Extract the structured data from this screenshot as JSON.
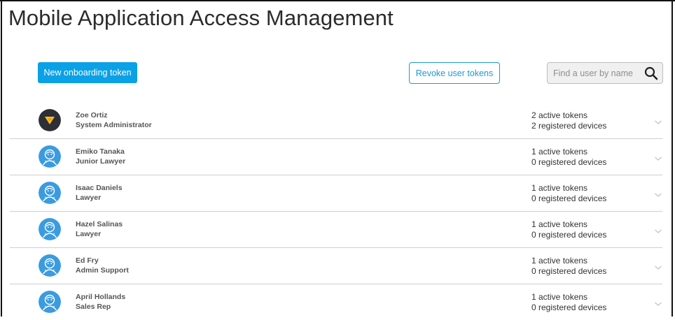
{
  "page": {
    "title": "Mobile Application Access Management"
  },
  "toolbar": {
    "new_token_label": "New onboarding token",
    "revoke_label": "Revoke user tokens"
  },
  "search": {
    "placeholder": "Find a user by name",
    "value": ""
  },
  "icons": {
    "search": "search-icon",
    "expand": "chevron-down-icon",
    "avatar_default": "user-avatar-icon",
    "avatar_brand": "brand-logo-icon"
  },
  "colors": {
    "primary": "#0aa1e6",
    "outline": "#1a9bd7",
    "avatar_blue": "#3a9be0",
    "avatar_dark": "#2c2f36",
    "logo_yellow": "#f7c31c"
  },
  "users": [
    {
      "name": "Zoe Ortiz",
      "role": "System Administrator",
      "tokens": "2 active tokens",
      "devices": "2 registered devices",
      "avatar": "brand"
    },
    {
      "name": "Emiko Tanaka",
      "role": "Junior Lawyer",
      "tokens": "1 active tokens",
      "devices": "0 registered devices",
      "avatar": "default"
    },
    {
      "name": "Isaac Daniels",
      "role": "Lawyer",
      "tokens": "1 active tokens",
      "devices": "0 registered devices",
      "avatar": "default"
    },
    {
      "name": "Hazel Salinas",
      "role": "Lawyer",
      "tokens": "1 active tokens",
      "devices": "0 registered devices",
      "avatar": "default"
    },
    {
      "name": "Ed Fry",
      "role": "Admin Support",
      "tokens": "1 active tokens",
      "devices": "0 registered devices",
      "avatar": "default"
    },
    {
      "name": "April Hollands",
      "role": "Sales Rep",
      "tokens": "1 active tokens",
      "devices": "0 registered devices",
      "avatar": "default"
    }
  ]
}
